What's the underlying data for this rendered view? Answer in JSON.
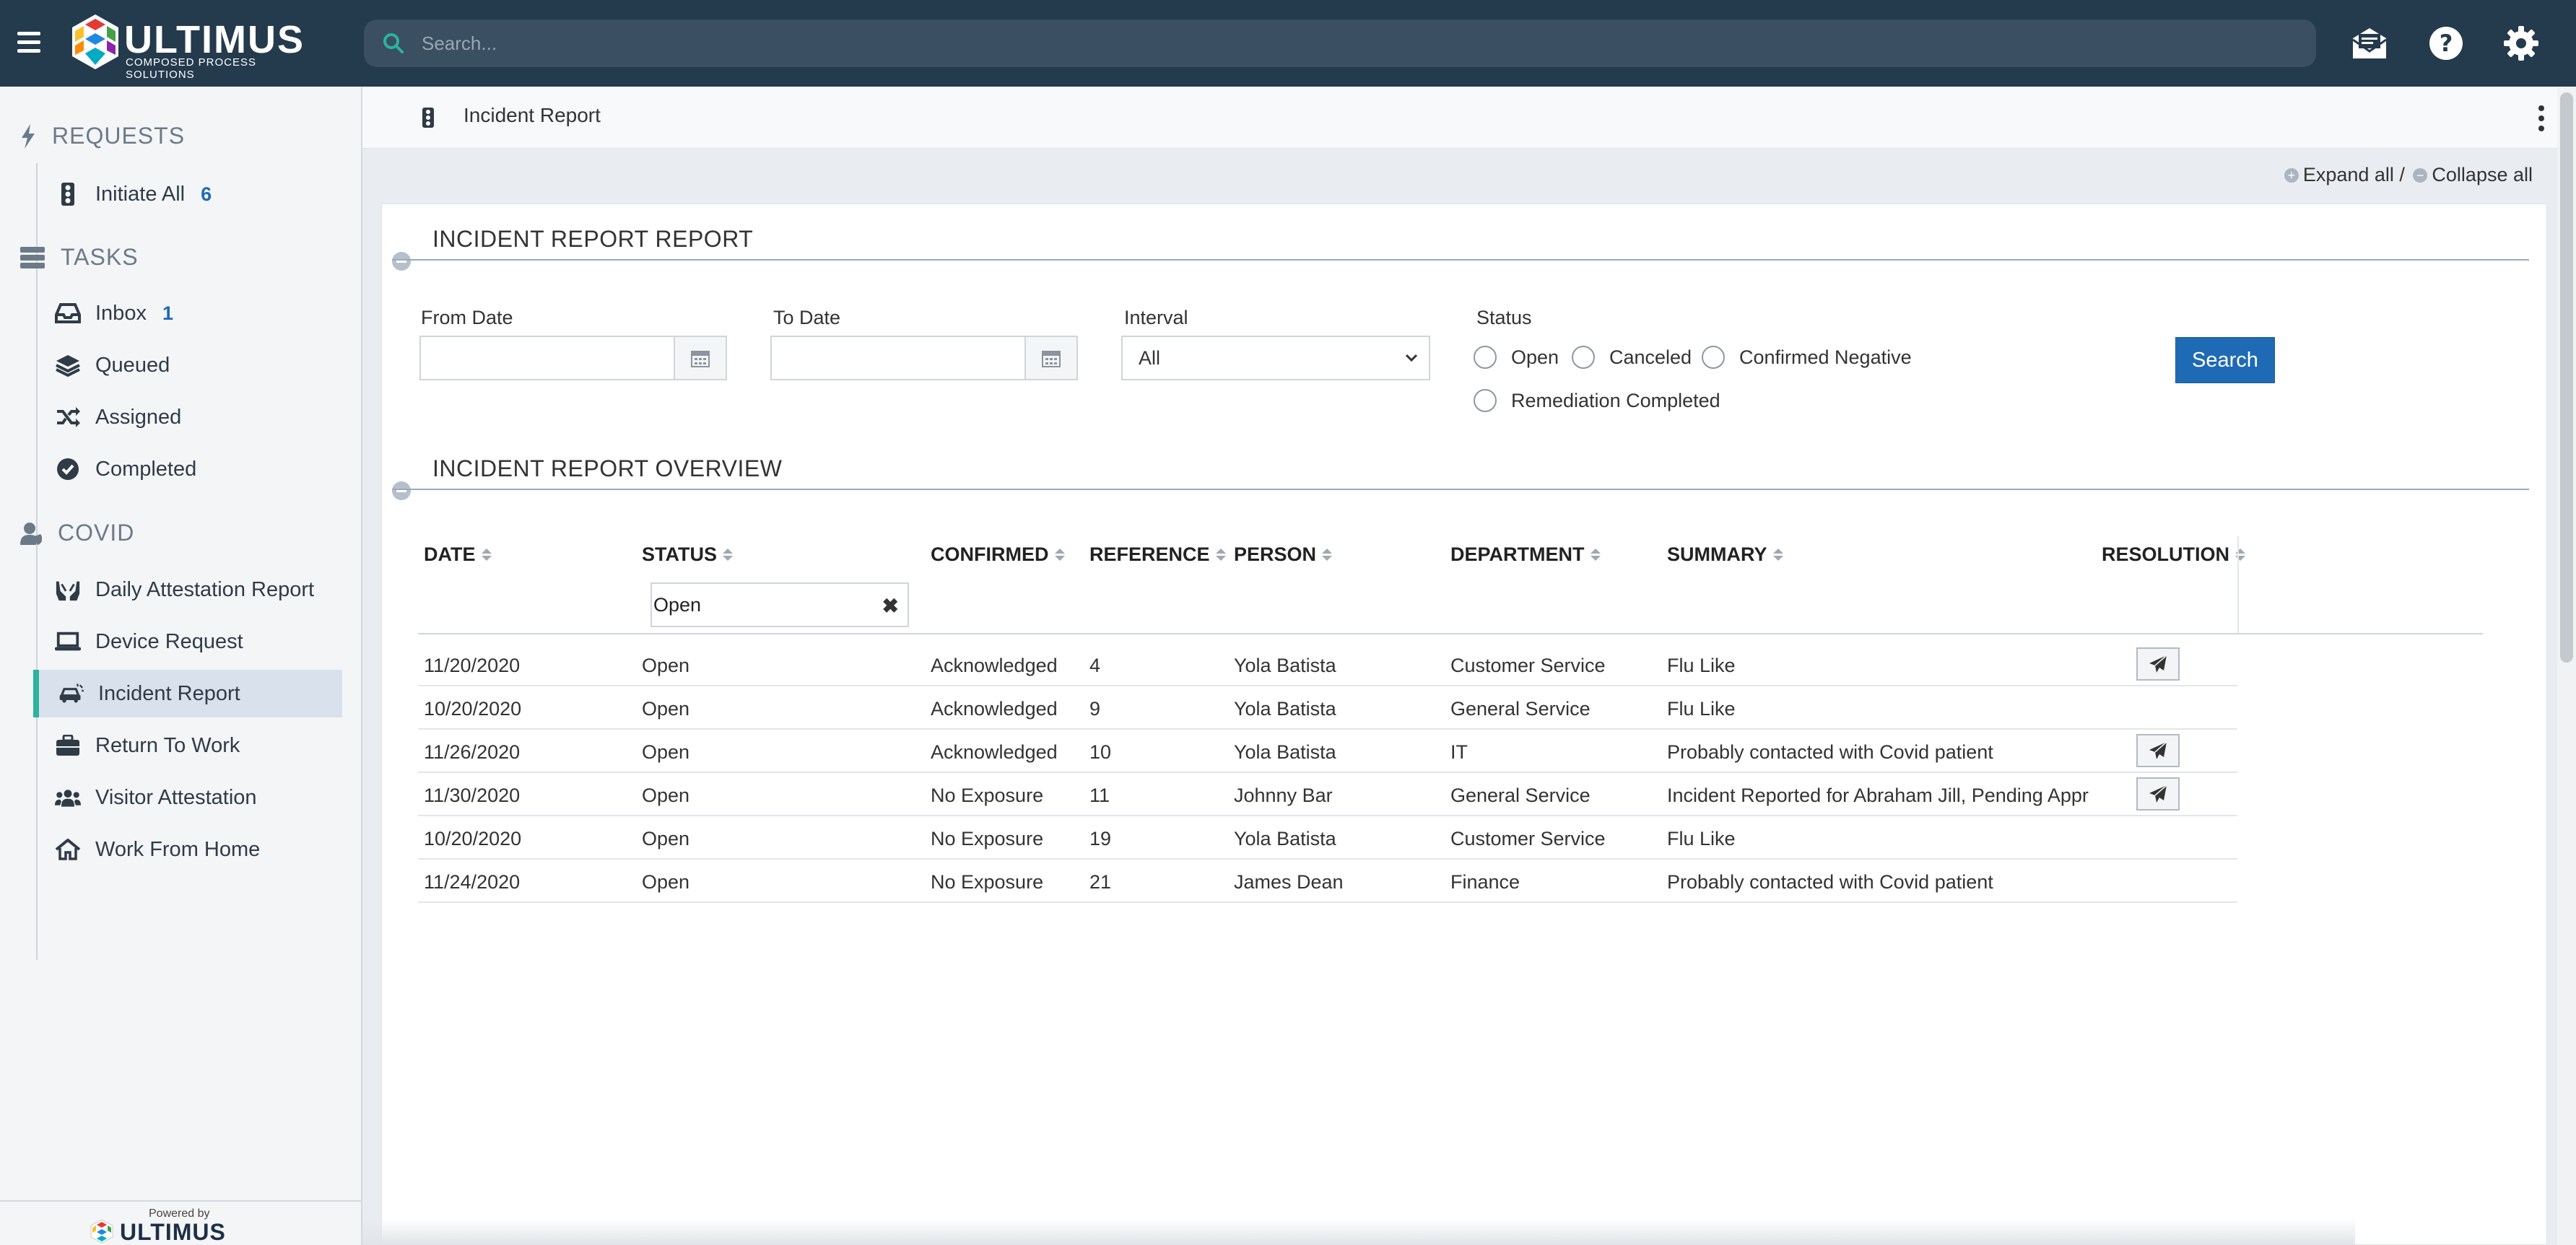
{
  "brand": {
    "name": "ULTIMUS",
    "tagline": "COMPOSED PROCESS SOLUTIONS",
    "powered_by": "Powered by",
    "powered_brand": "ULTIMUS"
  },
  "search": {
    "placeholder": "Search..."
  },
  "sidebar": {
    "sections": [
      {
        "label": "REQUESTS",
        "icon": "bolt-icon"
      },
      {
        "label": "TASKS",
        "icon": "tasks-icon"
      },
      {
        "label": "COVID",
        "icon": "user-shield-icon"
      }
    ],
    "items": [
      {
        "label": "Initiate All",
        "count": "6",
        "icon": "traffic-light-icon"
      },
      {
        "label": "Inbox",
        "count": "1",
        "icon": "inbox-icon"
      },
      {
        "label": "Queued",
        "icon": "layers-icon"
      },
      {
        "label": "Assigned",
        "icon": "shuffle-icon"
      },
      {
        "label": "Completed",
        "icon": "check-circle-icon"
      },
      {
        "label": "Daily Attestation Report",
        "icon": "hands-icon"
      },
      {
        "label": "Device Request",
        "icon": "laptop-icon"
      },
      {
        "label": "Incident Report",
        "icon": "car-crash-icon"
      },
      {
        "label": "Return To Work",
        "icon": "briefcase-icon"
      },
      {
        "label": "Visitor Attestation",
        "icon": "users-icon"
      },
      {
        "label": "Work From Home",
        "icon": "home-icon"
      }
    ]
  },
  "header": {
    "title": "Incident Report"
  },
  "expand": {
    "expand_label": "Expand all",
    "sep": " / ",
    "collapse_label": "Collapse all"
  },
  "report": {
    "title": "INCIDENT REPORT REPORT",
    "from_label": "From Date",
    "to_label": "To Date",
    "interval_label": "Interval",
    "interval_value": "All",
    "status_label": "Status",
    "status_options": [
      "Open",
      "Canceled",
      "Confirmed Negative",
      "Remediation Completed"
    ],
    "search_label": "Search"
  },
  "overview": {
    "title": "INCIDENT REPORT OVERVIEW",
    "columns": [
      "DATE",
      "STATUS",
      "CONFIRMED",
      "REFERENCE",
      "PERSON",
      "DEPARTMENT",
      "SUMMARY",
      "RESOLUTION"
    ],
    "status_filter": "Open",
    "rows": [
      {
        "date": "11/20/2020",
        "status": "Open",
        "confirmed": "Acknowledged",
        "reference": "4",
        "person": "Yola Batista",
        "department": "Customer Service",
        "summary": "Flu Like",
        "resolution": true
      },
      {
        "date": "10/20/2020",
        "status": "Open",
        "confirmed": "Acknowledged",
        "reference": "9",
        "person": "Yola Batista",
        "department": "General Service",
        "summary": "Flu Like",
        "resolution": false
      },
      {
        "date": "11/26/2020",
        "status": "Open",
        "confirmed": "Acknowledged",
        "reference": "10",
        "person": "Yola Batista",
        "department": "IT",
        "summary": "Probably contacted with Covid patient",
        "resolution": true
      },
      {
        "date": "11/30/2020",
        "status": "Open",
        "confirmed": "No Exposure",
        "reference": "11",
        "person": "Johnny Bar",
        "department": "General Service",
        "summary": "Incident Reported for Abraham Jill, Pending Appr",
        "resolution": true
      },
      {
        "date": "10/20/2020",
        "status": "Open",
        "confirmed": "No Exposure",
        "reference": "19",
        "person": "Yola Batista",
        "department": "Customer Service",
        "summary": "Flu Like",
        "resolution": false
      },
      {
        "date": "11/24/2020",
        "status": "Open",
        "confirmed": "No Exposure",
        "reference": "21",
        "person": "James Dean",
        "department": "Finance",
        "summary": "Probably contacted with Covid patient",
        "resolution": false
      }
    ]
  },
  "colors": {
    "topbar": "#243a4d",
    "accent": "#1f6ab5",
    "active_marker": "#2bb3a0"
  }
}
